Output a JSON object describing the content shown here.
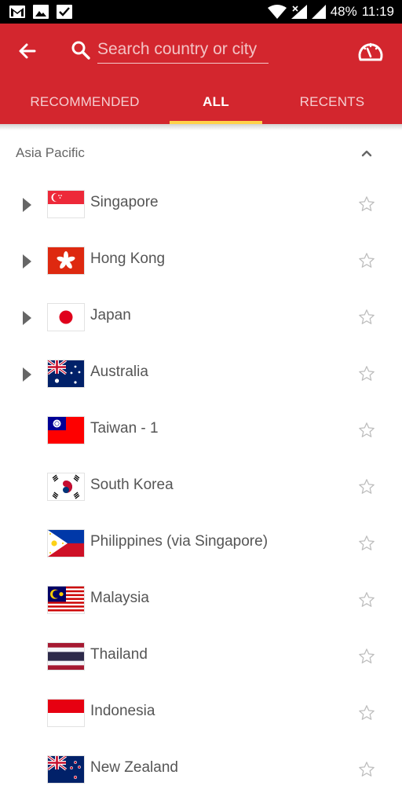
{
  "status_bar": {
    "battery": "48%",
    "time": "11:19",
    "left_icons": [
      "gmail-icon",
      "image-icon",
      "checklist-icon"
    ],
    "right_icons": [
      "wifi-icon",
      "signal-icon",
      "battery-icon"
    ]
  },
  "app_bar": {
    "back_icon": "arrow-left-icon",
    "search": {
      "placeholder": "Search country or city",
      "value": ""
    },
    "speedometer_icon": "speedometer-icon",
    "background_color": "#D3262E",
    "indicator_color": "#FFD24A"
  },
  "tabs": [
    {
      "label": "RECOMMENDED",
      "active": false
    },
    {
      "label": "ALL",
      "active": true
    },
    {
      "label": "RECENTS",
      "active": false
    }
  ],
  "section": {
    "title": "Asia Pacific",
    "expanded": true
  },
  "countries": [
    {
      "name": "Singapore",
      "flag": "sg",
      "expandable": true,
      "favorite": false
    },
    {
      "name": "Hong Kong",
      "flag": "hk",
      "expandable": true,
      "favorite": false
    },
    {
      "name": "Japan",
      "flag": "jp",
      "expandable": true,
      "favorite": false
    },
    {
      "name": "Australia",
      "flag": "au",
      "expandable": true,
      "favorite": false
    },
    {
      "name": "Taiwan - 1",
      "flag": "tw",
      "expandable": false,
      "favorite": false
    },
    {
      "name": "South Korea",
      "flag": "kr",
      "expandable": false,
      "favorite": false
    },
    {
      "name": "Philippines (via Singapore)",
      "flag": "ph",
      "expandable": false,
      "favorite": false
    },
    {
      "name": "Malaysia",
      "flag": "my",
      "expandable": false,
      "favorite": false
    },
    {
      "name": "Thailand",
      "flag": "th",
      "expandable": false,
      "favorite": false
    },
    {
      "name": "Indonesia",
      "flag": "id",
      "expandable": false,
      "favorite": false
    },
    {
      "name": "New Zealand",
      "flag": "nz",
      "expandable": false,
      "favorite": false
    }
  ]
}
